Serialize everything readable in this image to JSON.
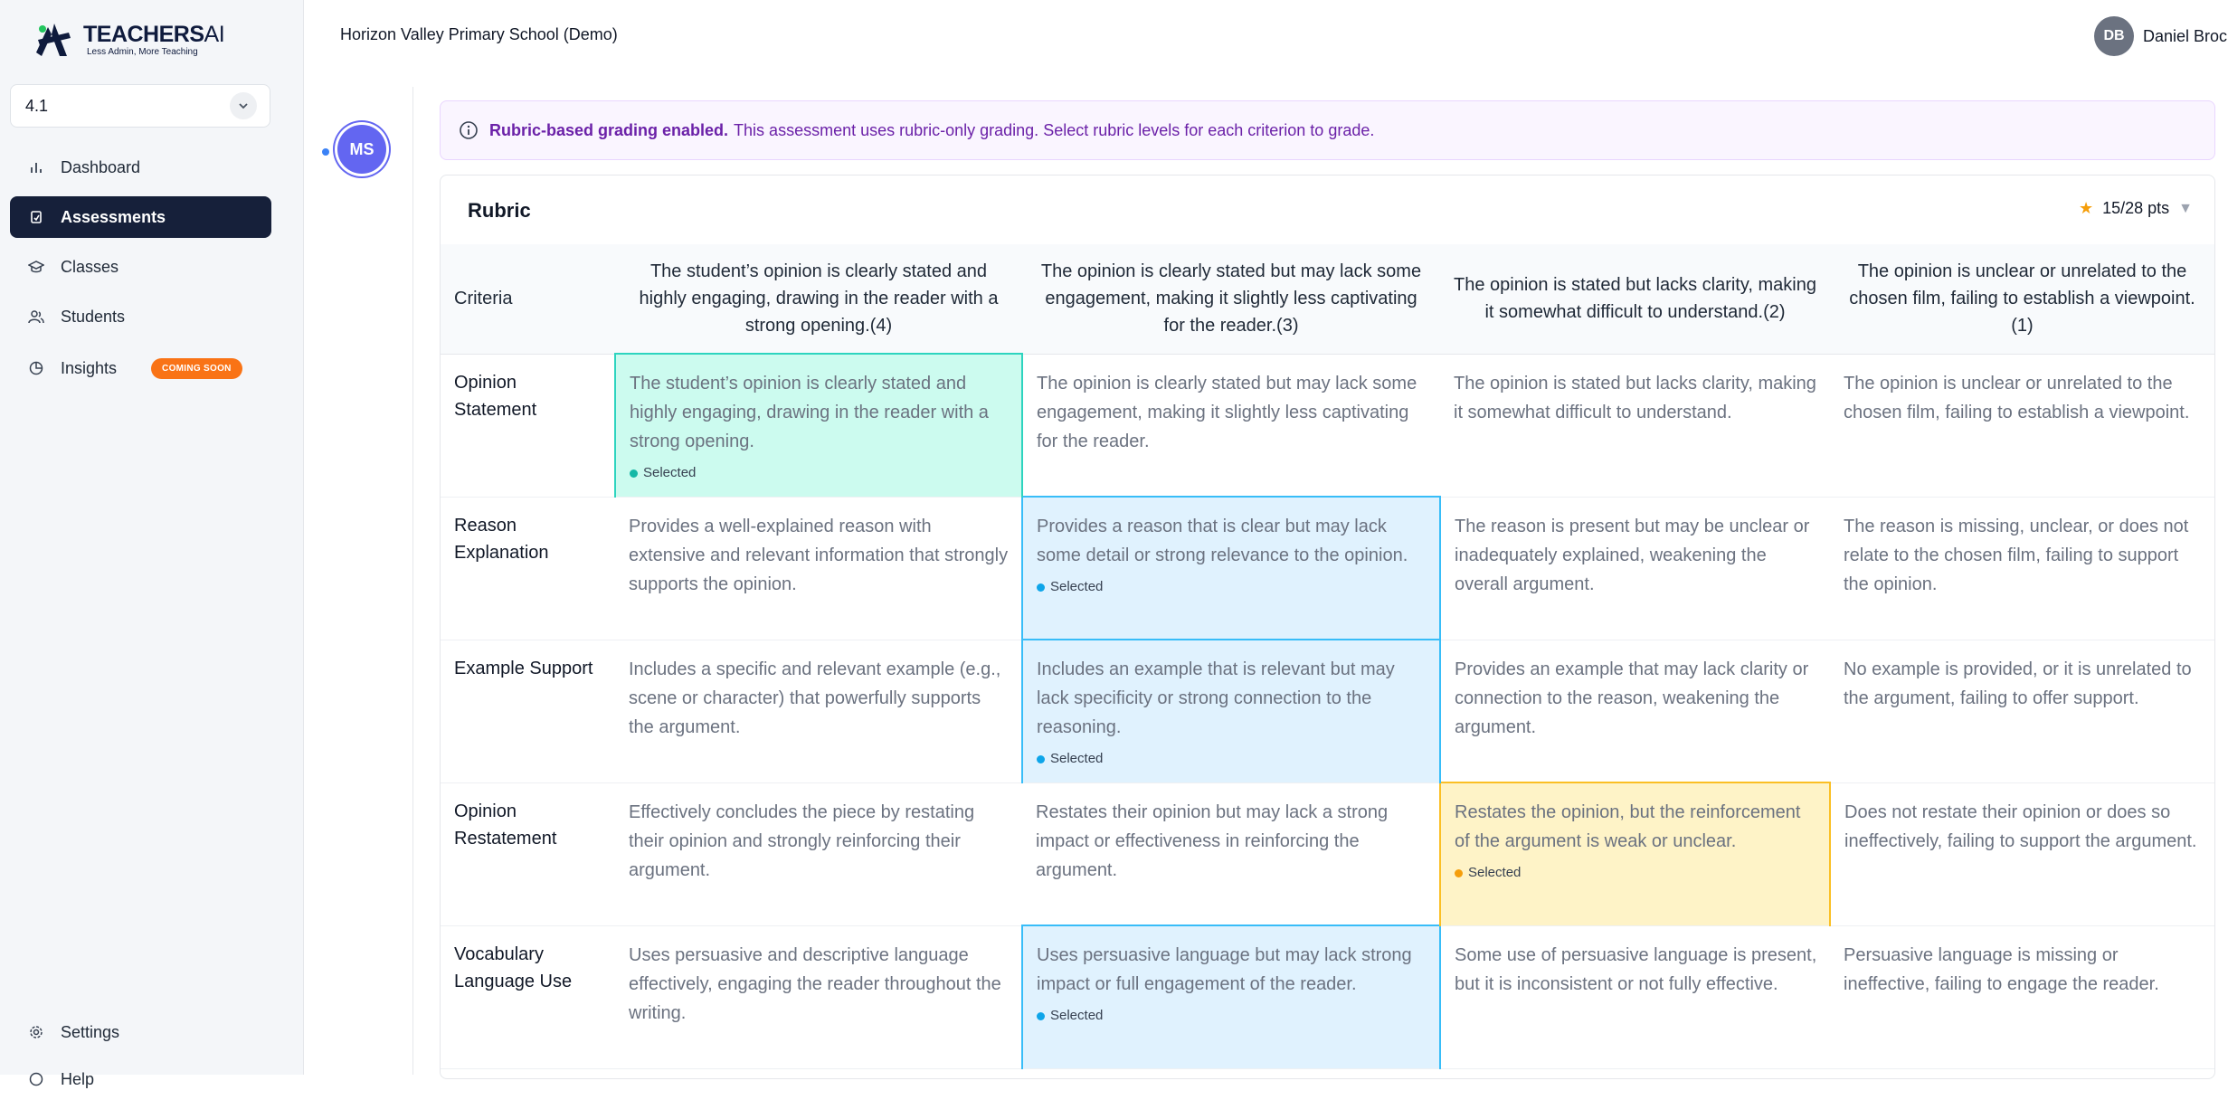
{
  "brand": {
    "name_bold": "TEACHERS",
    "name_light": "AI",
    "tagline": "Less Admin, More Teaching"
  },
  "class_selector": {
    "value": "4.1"
  },
  "nav": {
    "dashboard": "Dashboard",
    "assessments": "Assessments",
    "classes": "Classes",
    "students": "Students",
    "insights": "Insights",
    "insights_badge": "COMING SOON",
    "settings": "Settings",
    "help": "Help"
  },
  "header": {
    "school": "Horizon Valley Primary School (Demo)"
  },
  "user": {
    "initials": "DB",
    "name": "Daniel Brock"
  },
  "student": {
    "initials": "MS"
  },
  "banner": {
    "bold": "Rubric-based grading enabled.",
    "text": "This assessment uses rubric-only grading. Select rubric levels for each criterion to grade."
  },
  "rubric": {
    "title": "Rubric",
    "points": "15/28 pts",
    "criteria_header": "Criteria",
    "selected_label": "Selected",
    "levels": [
      "The student’s opinion is clearly stated and highly engaging, drawing in the reader with a strong opening.(4)",
      "The opinion is clearly stated but may lack some engagement, making it slightly less captivating for the reader.(3)",
      "The opinion is stated but lacks clarity, making it somewhat difficult to understand.(2)",
      "The opinion is unclear or unrelated to the chosen film, failing to establish a viewpoint.(1)"
    ],
    "rows": [
      {
        "criterion": "Opinion Statement",
        "selected_index": 0,
        "cells": [
          "The student’s opinion is clearly stated and highly engaging, drawing in the reader with a strong opening.",
          "The opinion is clearly stated but may lack some engagement, making it slightly less captivating for the reader.",
          "The opinion is stated but lacks clarity, making it somewhat difficult to understand.",
          "The opinion is unclear or unrelated to the chosen film, failing to establish a viewpoint."
        ]
      },
      {
        "criterion": "Reason Explanation",
        "selected_index": 1,
        "cells": [
          "Provides a well-explained reason with extensive and relevant information that strongly supports the opinion.",
          "Provides a reason that is clear but may lack some detail or strong relevance to the opinion.",
          "The reason is present but may be unclear or inadequately explained, weakening the overall argument.",
          "The reason is missing, unclear, or does not relate to the chosen film, failing to support the opinion."
        ]
      },
      {
        "criterion": "Example Support",
        "selected_index": 1,
        "cells": [
          "Includes a specific and relevant example (e.g., scene or character) that powerfully supports the argument.",
          "Includes an example that is relevant but may lack specificity or strong connection to the reasoning.",
          "Provides an example that may lack clarity or connection to the reason, weakening the argument.",
          "No example is provided, or it is unrelated to the argument, failing to offer support."
        ]
      },
      {
        "criterion": "Opinion Restatement",
        "selected_index": 2,
        "cells": [
          "Effectively concludes the piece by restating their opinion and strongly reinforcing their argument.",
          "Restates their opinion but may lack a strong impact or effectiveness in reinforcing the argument.",
          "Restates the opinion, but the reinforcement of the argument is weak or unclear.",
          "Does not restate their opinion or does so ineffectively, failing to support the argument."
        ]
      },
      {
        "criterion": "Vocabulary Language Use",
        "selected_index": 1,
        "cells": [
          "Uses persuasive and descriptive language effectively, engaging the reader throughout the writing.",
          "Uses persuasive language but may lack strong impact or full engagement of the reader.",
          "Some use of persuasive language is present, but it is inconsistent or not fully effective.",
          "Persuasive language is missing or ineffective, failing to engage the reader."
        ]
      }
    ]
  },
  "colors": {
    "accent_nav": "#16203a",
    "badge": "#f97316",
    "banner_text": "#6b21a8",
    "avatar_student": "#6366f1"
  },
  "icons": [
    "logo-icon",
    "chevron-down-icon",
    "bar-chart-icon",
    "assessment-icon",
    "graduation-cap-icon",
    "users-icon",
    "pie-chart-icon",
    "gear-icon",
    "help-icon",
    "info-icon",
    "star-icon",
    "triangle-down-icon"
  ]
}
